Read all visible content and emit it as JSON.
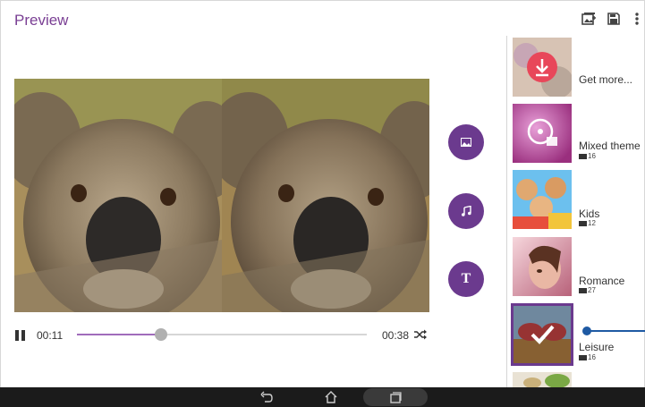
{
  "header": {
    "title": "Preview",
    "icons": [
      "add-photo-icon",
      "save-icon",
      "more-vert-icon"
    ]
  },
  "side_buttons": {
    "image_icon": "image-icon",
    "music_icon": "music-note-icon",
    "text_label": "T"
  },
  "player": {
    "current_time": "00:11",
    "total_time": "00:38",
    "progress": 0.29
  },
  "themes": [
    {
      "label": "Get more...",
      "count": null
    },
    {
      "label": "Mixed theme",
      "count": "16"
    },
    {
      "label": "Kids",
      "count": "12"
    },
    {
      "label": "Romance",
      "count": "27"
    },
    {
      "label": "Leisure",
      "count": "16",
      "selected": true
    }
  ],
  "colors": {
    "accent": "#6b3a8e",
    "title": "#7a3f94",
    "selection_line": "#1f5aa3"
  }
}
